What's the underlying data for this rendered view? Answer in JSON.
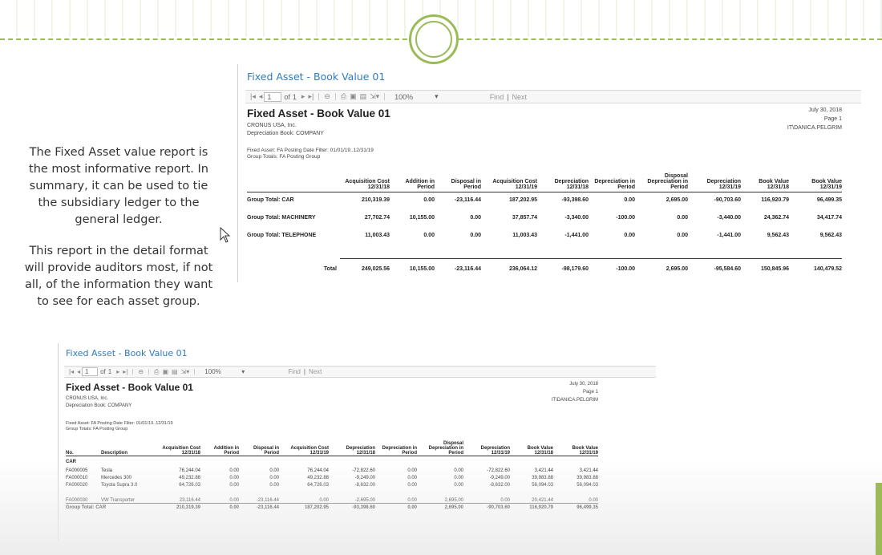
{
  "slide": {
    "paragraphs": [
      "The Fixed Asset value report is the most informative report. In summary, it can be used to tie the subsidiary ledger to the general ledger.",
      "This report in the detail format will provide auditors most, if not all, of the information they want to see for each asset group."
    ]
  },
  "colors": {
    "accent": "#9bbb59",
    "title_blue": "#2f7cc0"
  },
  "report1": {
    "window_title": "Fixed Asset - Book Value 01",
    "toolbar": {
      "page": "1",
      "of_label": "of",
      "of_value": "1",
      "zoom": "100%",
      "find_label": "Find",
      "next_label": "Next"
    },
    "heading": "Fixed Asset - Book Value 01",
    "company": "CRONUS USA, Inc.",
    "depreciation_book": "Depreciation Book: COMPANY",
    "date": "July 30, 2018",
    "page": "Page 1",
    "user": "IT\\DANICA.PELGRIM",
    "filter": "Fixed Asset: FA Posting Date Filter: 01/01/19..12/31/19",
    "group_totals": "Group Totals: FA Posting Group",
    "columns": [
      "",
      "Acquisition Cost 12/31/18",
      "Addition in Period",
      "Disposal in Period",
      "Acquisition Cost 12/31/19",
      "Depreciation 12/31/18",
      "Depreciation in Period",
      "Disposal Depreciation in Period",
      "Depreciation 12/31/19",
      "Book Value 12/31/18",
      "Book Value 12/31/19"
    ],
    "rows": [
      [
        "Group Total: CAR",
        "210,319.39",
        "0.00",
        "-23,116.44",
        "187,202.95",
        "-93,398.60",
        "0.00",
        "2,695.00",
        "-90,703.60",
        "116,920.79",
        "96,499.35"
      ],
      [
        "Group Total: MACHINERY",
        "27,702.74",
        "10,155.00",
        "0.00",
        "37,857.74",
        "-3,340.00",
        "-100.00",
        "0.00",
        "-3,440.00",
        "24,362.74",
        "34,417.74"
      ],
      [
        "Group Total: TELEPHONE",
        "11,003.43",
        "0.00",
        "0.00",
        "11,003.43",
        "-1,441.00",
        "0.00",
        "0.00",
        "-1,441.00",
        "9,562.43",
        "9,562.43"
      ]
    ],
    "total": [
      "Total",
      "249,025.56",
      "10,155.00",
      "-23,116.44",
      "236,064.12",
      "-98,179.60",
      "-100.00",
      "2,695.00",
      "-95,584.60",
      "150,845.96",
      "140,479.52"
    ]
  },
  "report2": {
    "window_title": "Fixed Asset - Book Value 01",
    "toolbar": {
      "page": "1",
      "of_label": "of",
      "of_value": "1",
      "zoom": "100%",
      "find_label": "Find",
      "next_label": "Next"
    },
    "heading": "Fixed Asset - Book Value 01",
    "company": "CRONUS USA, Inc.",
    "depreciation_book": "Depreciation Book: COMPANY",
    "date": "July 30, 2018",
    "page": "Page 1",
    "user": "IT\\DANICA.PELGRIM",
    "filter": "Fixed Asset: FA Posting Date Filter: 01/01/19..12/31/19",
    "group_totals": "Group Totals: FA Posting Group",
    "columns": [
      "No.",
      "Description",
      "Acquisition Cost 12/31/18",
      "Addition in Period",
      "Disposal in Period",
      "Acquisition Cost 12/31/19",
      "Depreciation 12/31/18",
      "Depreciation in Period",
      "Disposal Depreciation in Period",
      "Depreciation 12/31/19",
      "Book Value 12/31/18",
      "Book Value 12/31/19"
    ],
    "group_label": "CAR",
    "rows": [
      [
        "FA000005",
        "Tesla",
        "76,244.04",
        "0.00",
        "0.00",
        "76,244.04",
        "-72,822.60",
        "0.00",
        "0.00",
        "-72,822.60",
        "3,421.44",
        "3,421.44"
      ],
      [
        "FA000010",
        "Mercedes 300",
        "49,232.88",
        "0.00",
        "0.00",
        "49,232.88",
        "-9,249.00",
        "0.00",
        "0.00",
        "-9,249.00",
        "39,983.88",
        "39,983.88"
      ],
      [
        "FA000020",
        "Toyota Supra 3.0",
        "64,726.03",
        "0.00",
        "0.00",
        "64,726.03",
        "-8,632.00",
        "0.00",
        "0.00",
        "-8,632.00",
        "56,094.03",
        "56,094.03"
      ],
      [
        "FA000030",
        "VW Transporter",
        "23,116.44",
        "0.00",
        "-23,116.44",
        "0.00",
        "-2,695.00",
        "0.00",
        "2,695.00",
        "0.00",
        "20,421.44",
        "0.00"
      ]
    ],
    "group_total": [
      "Group Total: CAR",
      "",
      "210,319.39",
      "0.00",
      "-23,116.44",
      "187,202.95",
      "-93,398.60",
      "0.00",
      "2,695.00",
      "-90,703.60",
      "116,920.79",
      "96,499.35"
    ]
  }
}
